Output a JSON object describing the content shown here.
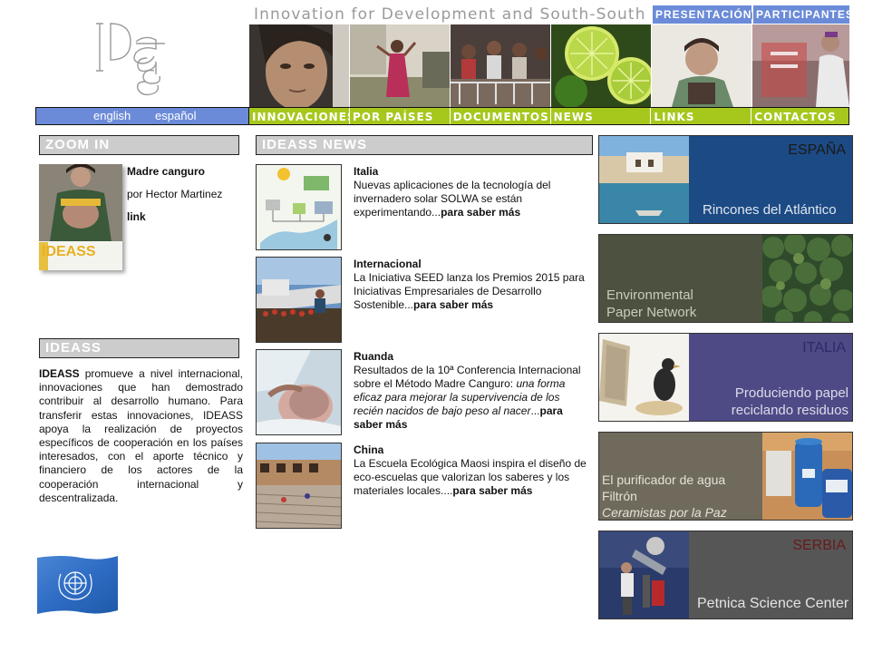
{
  "tagline": "Innovation for Development and South-South cooperation",
  "top_nav": [
    {
      "label": "PRESENTACIÓN"
    },
    {
      "label": "PARTICIPANTES"
    }
  ],
  "language_links": [
    {
      "label": "english"
    },
    {
      "label": "español"
    }
  ],
  "main_nav": [
    {
      "label": "INNOVACIONES"
    },
    {
      "label": "POR PAÍSES"
    },
    {
      "label": "DOCUMENTOS"
    },
    {
      "label": "NEWS"
    },
    {
      "label": "LINKS"
    },
    {
      "label": "CONTACTOS"
    }
  ],
  "zoom_in": {
    "heading": "ZOOM IN",
    "title": "Madre canguro",
    "author": "por Hector Martinez",
    "link": "link",
    "cover_brand": "IDEASS"
  },
  "ideass_section": {
    "heading": "IDEASS",
    "brand": "IDEASS",
    "body": " promueve a nivel internacional, innovaciones que han demostrado contribuir al desarrollo humano. Para transferir estas innovaciones, IDEASS apoya la realización de proyectos específicos de cooperación en los países interesados, con el aporte técnico y financiero de los actores de la cooperación internacional y descentralizada."
  },
  "news": {
    "heading": "IDEASS NEWS",
    "items": [
      {
        "region": "Italia",
        "text": "Nuevas aplicaciones de la tecnología del invernadero solar SOLWA se están experimentando...",
        "emphasis": "",
        "more": "para saber más"
      },
      {
        "region": "Internacional",
        "text": "La Iniciativa SEED lanza los Premios 2015 para Iniciativas Empresariales de Desarrollo Sostenible...",
        "emphasis": "",
        "more": "para saber más"
      },
      {
        "region": "Ruanda",
        "text": "Resultados de la 10ª Conferencia Internacional sobre el Método Madre Canguro: ",
        "emphasis": "una forma eficaz para mejorar la supervivencia de los recién nacidos de bajo peso al nacer",
        "after": "...",
        "more": "para saber más"
      },
      {
        "region": "China",
        "text": "La Escuela Ecológica Maosi inspira el diseño de eco-escuelas que valorizan los saberes y los materiales locales....",
        "emphasis": "",
        "more": "para saber más"
      }
    ]
  },
  "cards": [
    {
      "country": "ESPAÑA",
      "label": "Rincones del Atlántico"
    },
    {
      "line1": "Environmental",
      "line2": "Paper Network"
    },
    {
      "country": "ITALIA",
      "line1": "Produciendo papel",
      "line2": "reciclando residuos"
    },
    {
      "line1": "El purificador de agua",
      "line2": "Filtrón",
      "line3": "Ceramistas por la Paz"
    },
    {
      "country": "SERBIA",
      "label": "Petnica Science Center"
    }
  ],
  "colors": {
    "nav_blue": "#6b8bd8",
    "nav_green": "#a6c81d",
    "section_gray": "#cccccc",
    "card_navy": "#1c4a84",
    "card_olive": "#4d5240",
    "card_purple": "#4e4a86",
    "card_taupe": "#6f6a5c",
    "card_gray": "#565656"
  }
}
